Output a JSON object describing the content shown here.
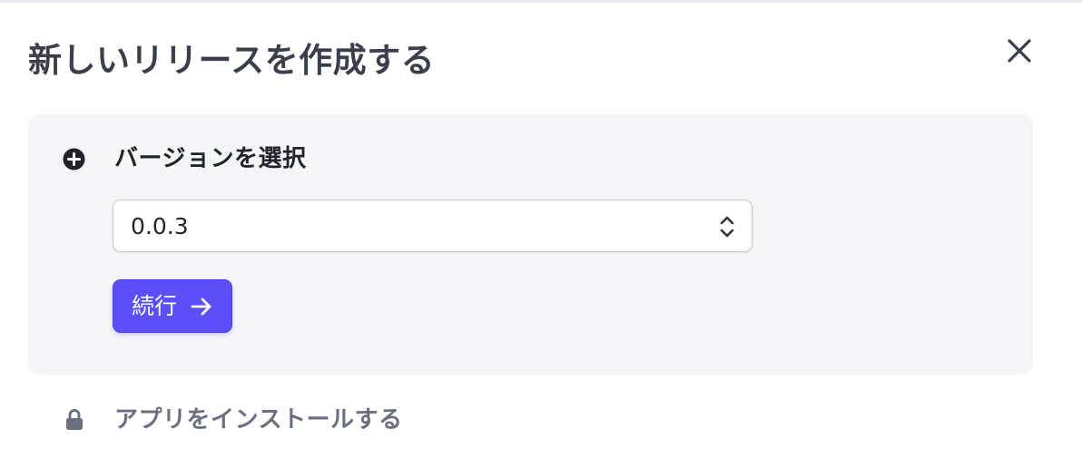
{
  "dialog": {
    "title": "新しいリリースを作成する",
    "close_icon": "close-icon"
  },
  "step_select_version": {
    "icon": "plus-circle-icon",
    "title": "バージョンを選択",
    "select": {
      "selected_value": "0.0.3",
      "chevron_icon": "chevron-up-down-icon"
    },
    "continue_button": {
      "label": "続行",
      "icon": "arrow-right-icon",
      "color": "#5b4ff7"
    }
  },
  "step_install_app": {
    "icon": "lock-icon",
    "title": "アプリをインストールする"
  },
  "colors": {
    "accent": "#5b4ff7",
    "panel_background": "#f4f5f8",
    "title_text": "#3a3f4b",
    "muted_text": "#6b7080"
  }
}
